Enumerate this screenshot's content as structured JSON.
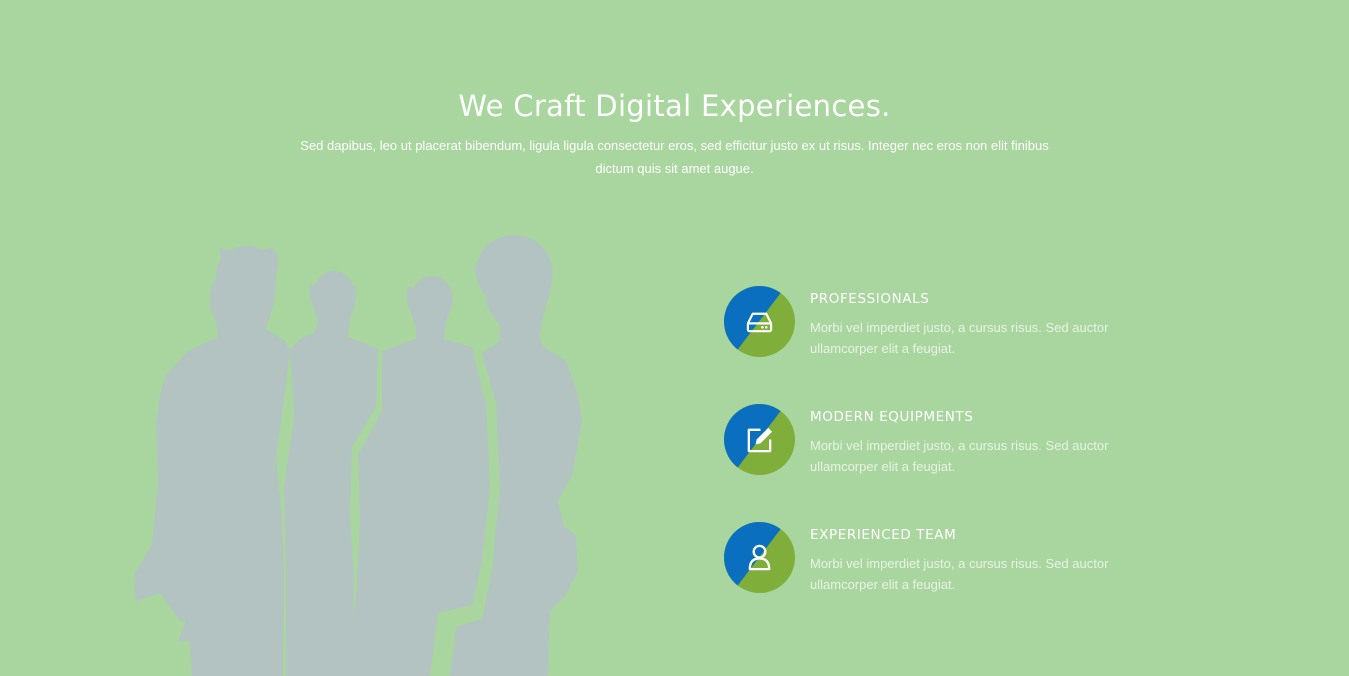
{
  "hero": {
    "title": "We Craft Digital Experiences.",
    "subtitle": "Sed dapibus, leo ut placerat bibendum, ligula ligula consectetur eros, sed efficitur justo ex ut risus. Integer nec eros non elit finibus dictum quis sit amet augue."
  },
  "features": [
    {
      "icon": "hard-drive-icon",
      "title": "PROFESSIONALS",
      "text": "Morbi vel imperdiet justo, a cursus risus. Sed auctor ullamcorper elit a feugiat."
    },
    {
      "icon": "edit-icon",
      "title": "MODERN EQUIPMENTS",
      "text": "Morbi vel imperdiet justo, a cursus risus. Sed auctor ullamcorper elit a feugiat."
    },
    {
      "icon": "user-icon",
      "title": "EXPERIENCED TEAM",
      "text": "Morbi vel imperdiet justo, a cursus risus. Sed auctor ullamcorper elit a feugiat."
    }
  ],
  "colors": {
    "background": "#a8d69e",
    "badge_blue": "#0a6fbe",
    "badge_green": "#7fae3a",
    "silhouette": "#b2c3c2"
  }
}
